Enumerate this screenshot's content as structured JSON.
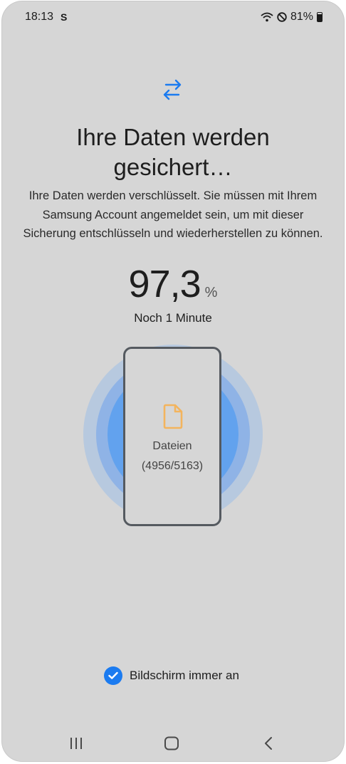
{
  "status_bar": {
    "time": "18:13",
    "battery": "81%",
    "icons": [
      "s-icon",
      "wifi-icon",
      "do-not-disturb-icon",
      "battery-icon"
    ]
  },
  "main": {
    "header_icon": "transfer-arrows-icon",
    "title": "Ihre Daten werden\ngesichert…",
    "description": "Ihre Daten werden verschlüsselt. Sie müssen mit Ihrem Samsung Account angemeldet sein, um mit dieser Sicherung entschlüsseln und wiederherstellen zu können.",
    "progress_value": "97,3",
    "progress_unit": "%",
    "progress_percent": 97.3,
    "time_remaining": "Noch 1 Minute",
    "current_item": {
      "icon": "file-icon",
      "label": "Dateien",
      "count": "(4956/5163)"
    },
    "keep_screen_on": {
      "label": "Bildschirm immer an",
      "checked": true
    }
  },
  "nav_bar": {
    "buttons": [
      "recent-apps",
      "home",
      "back"
    ]
  },
  "colors": {
    "accent": "#1b7bf0",
    "file_icon": "#f3b45e",
    "background": "#d6d6d6"
  }
}
